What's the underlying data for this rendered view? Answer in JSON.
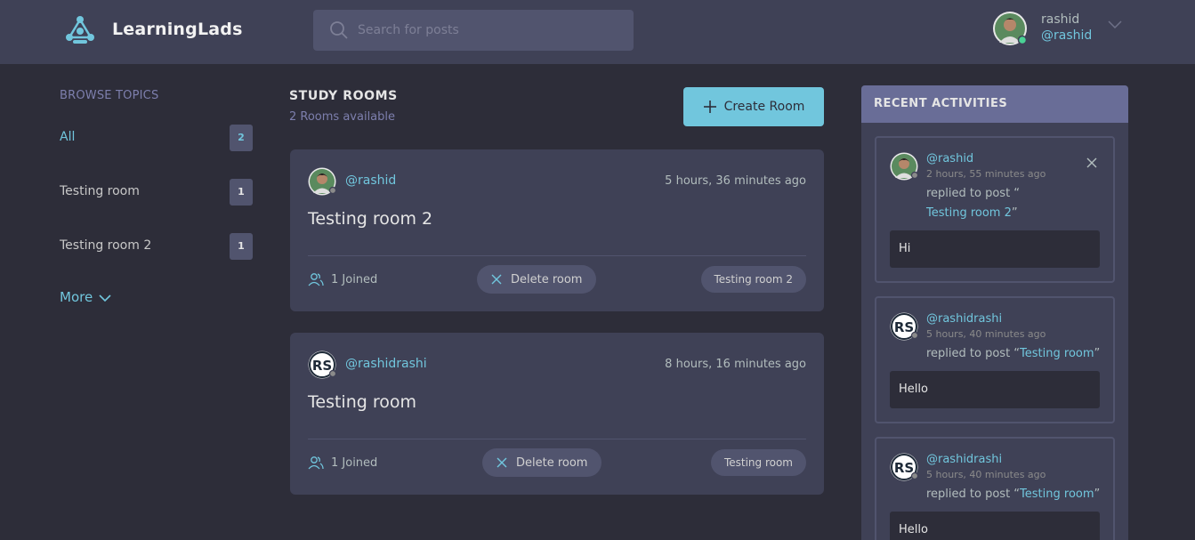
{
  "header": {
    "brand": "LearningLads",
    "search_placeholder": "Search for posts",
    "user": {
      "name": "rashid",
      "handle": "@rashid"
    }
  },
  "sidebar": {
    "title": "BROWSE TOPICS",
    "topics": [
      {
        "label": "All",
        "count": "2",
        "active": true
      },
      {
        "label": "Testing room",
        "count": "1"
      },
      {
        "label": "Testing room 2",
        "count": "1"
      }
    ],
    "more": "More"
  },
  "rooms": {
    "title": "STUDY ROOMS",
    "subtitle": "2 Rooms available",
    "create_label": "Create Room",
    "items": [
      {
        "handle": "@rashid",
        "time": "5 hours, 36 minutes ago",
        "title": "Testing room 2",
        "joined": "1 Joined",
        "delete_label": "Delete room",
        "topic": "Testing room 2"
      },
      {
        "handle": "@rashidrashi",
        "time": "8 hours, 16 minutes ago",
        "title": "Testing room",
        "joined": "1 Joined",
        "delete_label": "Delete room",
        "topic": "Testing room"
      }
    ]
  },
  "activities": {
    "title": "RECENT ACTIVITIES",
    "items": [
      {
        "handle": "@rashid",
        "time": "2 hours, 55 minutes ago",
        "reply_prefix": "replied to post “",
        "post": "Testing room 2",
        "reply_suffix": "”",
        "message": "Hi"
      },
      {
        "handle": "@rashidrashi",
        "time": "5 hours, 40 minutes ago",
        "reply_prefix": "replied to post “",
        "post": "Testing room",
        "reply_suffix": "”",
        "message": "Hello"
      },
      {
        "handle": "@rashidrashi",
        "time": "5 hours, 40 minutes ago",
        "reply_prefix": "replied to post “",
        "post": "Testing room",
        "reply_suffix": "”",
        "message": "Hello"
      }
    ]
  },
  "colors": {
    "accent": "#71c6dd",
    "background": "#2d2d39",
    "card": "#3f4156",
    "header_purple": "#696d97"
  }
}
